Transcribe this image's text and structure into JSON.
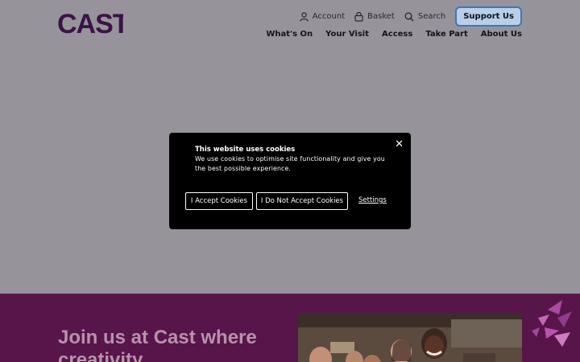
{
  "header": {
    "logo_text": "CAST",
    "utility": {
      "account": "Account",
      "basket": "Basket",
      "search": "Search",
      "support": "Support Us"
    },
    "nav": [
      "What's On",
      "Your Visit",
      "Access",
      "Take Part",
      "About Us"
    ]
  },
  "cookie": {
    "title": "This website uses cookies",
    "text": "We use cookies to optimise site functionality and give you the best possible experience.",
    "accept": "I Accept Cookies",
    "decline": "I Do Not Accept Cookies",
    "settings": "Settings",
    "close": "✕"
  },
  "hero": {
    "heading": "Join us at Cast where creativity"
  },
  "colors": {
    "page_overlay": "#97939b",
    "band": "#571549",
    "logo": "#3a1346",
    "support_border": "#3f77b8"
  }
}
